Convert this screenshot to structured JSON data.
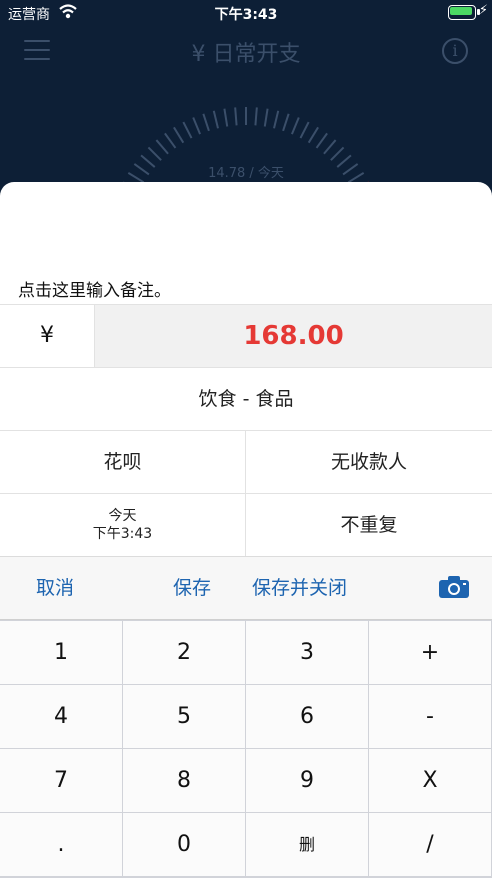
{
  "status": {
    "carrier": "运营商",
    "time": "下午3:43"
  },
  "header": {
    "title": "¥ 日常开支",
    "info": "i"
  },
  "gauge": {
    "label": "14.78 / 今天"
  },
  "memo": {
    "placeholder": "点击这里输入备注。"
  },
  "amount": {
    "currency": "¥",
    "value": "168.00"
  },
  "category": "饮食 - 食品",
  "account": "花呗",
  "payee": "无收款人",
  "date": {
    "day": "今天",
    "time": "下午3:43"
  },
  "repeat": "不重复",
  "actions": {
    "cancel": "取消",
    "save": "保存",
    "save_close": "保存并关闭"
  },
  "keys": [
    "1",
    "2",
    "3",
    "+",
    "4",
    "5",
    "6",
    "-",
    "7",
    "8",
    "9",
    "X",
    ".",
    "0",
    "删",
    "/"
  ],
  "colors": {
    "accent": "#1d64b0",
    "amount": "#e53935",
    "battery": "#4cd964"
  }
}
